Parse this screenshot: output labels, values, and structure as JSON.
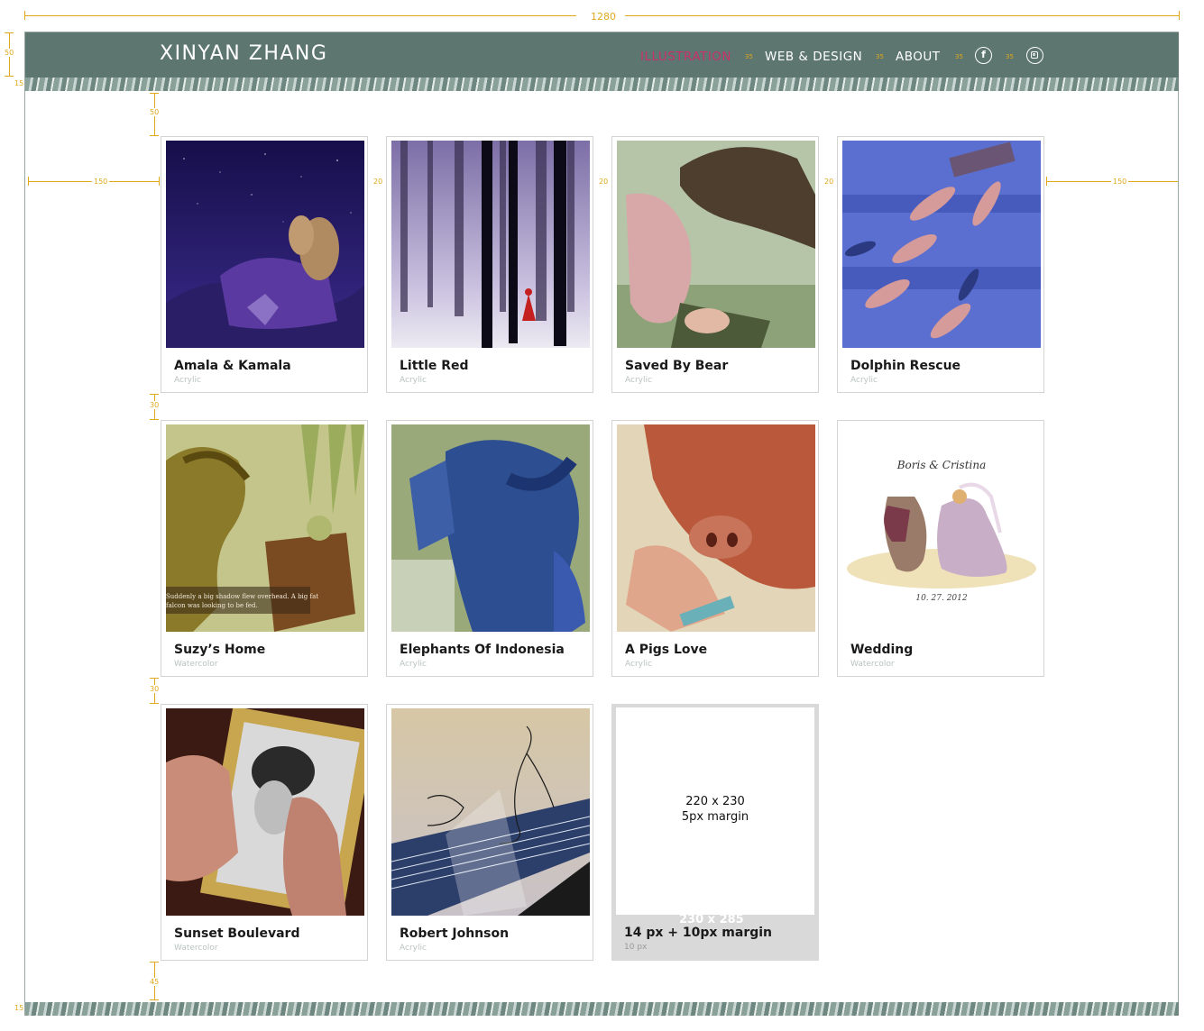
{
  "spec": {
    "page_width": "1280",
    "header_height": "50",
    "banner_height": "15",
    "top_margin": "50",
    "side_margin": "150",
    "gutter": "20",
    "row_gap": "30",
    "bottom_margin": "45",
    "nav_spacing": "35"
  },
  "header": {
    "logo": "XINYAN ZHANG",
    "nav": [
      {
        "label": "ILLUSTRATION",
        "active": true
      },
      {
        "label": "WEB & DESIGN",
        "active": false
      },
      {
        "label": "ABOUT",
        "active": false
      }
    ],
    "social": [
      "facebook-icon",
      "instagram-icon"
    ]
  },
  "gallery": [
    {
      "title": "Amala & Kamala",
      "medium": "Acrylic"
    },
    {
      "title": "Little Red",
      "medium": "Acrylic"
    },
    {
      "title": "Saved By Bear",
      "medium": "Acrylic"
    },
    {
      "title": "Dolphin Rescue",
      "medium": "Acrylic"
    },
    {
      "title": "Suzy’s Home",
      "medium": "Watercolor",
      "caption": "Suddenly a big shadow flew overhead. A big fat falcon was looking to be fed."
    },
    {
      "title": "Elephants Of Indonesia",
      "medium": "Acrylic"
    },
    {
      "title": "A Pigs Love",
      "medium": "Acrylic"
    },
    {
      "title": "Wedding",
      "medium": "Watercolor",
      "names": "Boris & Cristina",
      "date": "10. 27. 2012"
    },
    {
      "title": "Sunset Boulevard",
      "medium": "Watercolor"
    },
    {
      "title": "Robert Johnson",
      "medium": "Acrylic"
    }
  ],
  "placeholder": {
    "line1": "220 x 230",
    "line2": "5px margin",
    "size": "230 x 285",
    "title": "14 px + 10px margin",
    "sub": "10 px"
  },
  "colors": {
    "header": "#5d7670",
    "accent": "#c8326a",
    "annotation": "#e0a81c"
  }
}
